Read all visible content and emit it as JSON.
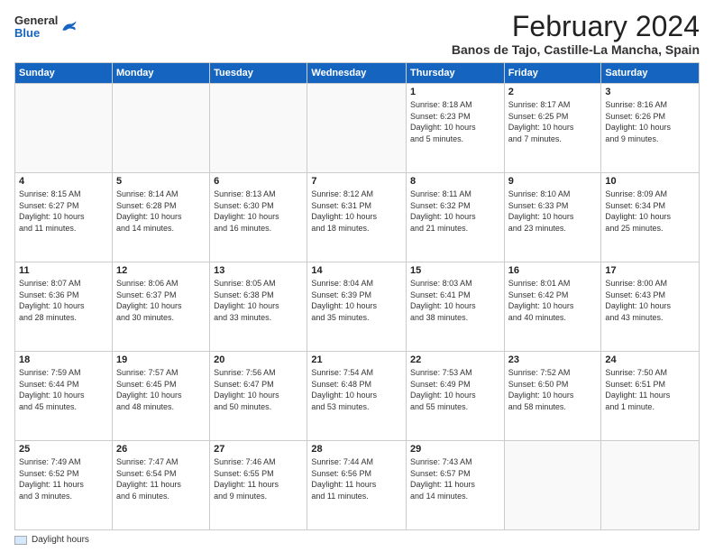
{
  "logo": {
    "general": "General",
    "blue": "Blue"
  },
  "title": "February 2024",
  "subtitle": "Banos de Tajo, Castille-La Mancha, Spain",
  "days_of_week": [
    "Sunday",
    "Monday",
    "Tuesday",
    "Wednesday",
    "Thursday",
    "Friday",
    "Saturday"
  ],
  "legend_label": "Daylight hours",
  "weeks": [
    [
      {
        "day": "",
        "info": ""
      },
      {
        "day": "",
        "info": ""
      },
      {
        "day": "",
        "info": ""
      },
      {
        "day": "",
        "info": ""
      },
      {
        "day": "1",
        "info": "Sunrise: 8:18 AM\nSunset: 6:23 PM\nDaylight: 10 hours\nand 5 minutes."
      },
      {
        "day": "2",
        "info": "Sunrise: 8:17 AM\nSunset: 6:25 PM\nDaylight: 10 hours\nand 7 minutes."
      },
      {
        "day": "3",
        "info": "Sunrise: 8:16 AM\nSunset: 6:26 PM\nDaylight: 10 hours\nand 9 minutes."
      }
    ],
    [
      {
        "day": "4",
        "info": "Sunrise: 8:15 AM\nSunset: 6:27 PM\nDaylight: 10 hours\nand 11 minutes."
      },
      {
        "day": "5",
        "info": "Sunrise: 8:14 AM\nSunset: 6:28 PM\nDaylight: 10 hours\nand 14 minutes."
      },
      {
        "day": "6",
        "info": "Sunrise: 8:13 AM\nSunset: 6:30 PM\nDaylight: 10 hours\nand 16 minutes."
      },
      {
        "day": "7",
        "info": "Sunrise: 8:12 AM\nSunset: 6:31 PM\nDaylight: 10 hours\nand 18 minutes."
      },
      {
        "day": "8",
        "info": "Sunrise: 8:11 AM\nSunset: 6:32 PM\nDaylight: 10 hours\nand 21 minutes."
      },
      {
        "day": "9",
        "info": "Sunrise: 8:10 AM\nSunset: 6:33 PM\nDaylight: 10 hours\nand 23 minutes."
      },
      {
        "day": "10",
        "info": "Sunrise: 8:09 AM\nSunset: 6:34 PM\nDaylight: 10 hours\nand 25 minutes."
      }
    ],
    [
      {
        "day": "11",
        "info": "Sunrise: 8:07 AM\nSunset: 6:36 PM\nDaylight: 10 hours\nand 28 minutes."
      },
      {
        "day": "12",
        "info": "Sunrise: 8:06 AM\nSunset: 6:37 PM\nDaylight: 10 hours\nand 30 minutes."
      },
      {
        "day": "13",
        "info": "Sunrise: 8:05 AM\nSunset: 6:38 PM\nDaylight: 10 hours\nand 33 minutes."
      },
      {
        "day": "14",
        "info": "Sunrise: 8:04 AM\nSunset: 6:39 PM\nDaylight: 10 hours\nand 35 minutes."
      },
      {
        "day": "15",
        "info": "Sunrise: 8:03 AM\nSunset: 6:41 PM\nDaylight: 10 hours\nand 38 minutes."
      },
      {
        "day": "16",
        "info": "Sunrise: 8:01 AM\nSunset: 6:42 PM\nDaylight: 10 hours\nand 40 minutes."
      },
      {
        "day": "17",
        "info": "Sunrise: 8:00 AM\nSunset: 6:43 PM\nDaylight: 10 hours\nand 43 minutes."
      }
    ],
    [
      {
        "day": "18",
        "info": "Sunrise: 7:59 AM\nSunset: 6:44 PM\nDaylight: 10 hours\nand 45 minutes."
      },
      {
        "day": "19",
        "info": "Sunrise: 7:57 AM\nSunset: 6:45 PM\nDaylight: 10 hours\nand 48 minutes."
      },
      {
        "day": "20",
        "info": "Sunrise: 7:56 AM\nSunset: 6:47 PM\nDaylight: 10 hours\nand 50 minutes."
      },
      {
        "day": "21",
        "info": "Sunrise: 7:54 AM\nSunset: 6:48 PM\nDaylight: 10 hours\nand 53 minutes."
      },
      {
        "day": "22",
        "info": "Sunrise: 7:53 AM\nSunset: 6:49 PM\nDaylight: 10 hours\nand 55 minutes."
      },
      {
        "day": "23",
        "info": "Sunrise: 7:52 AM\nSunset: 6:50 PM\nDaylight: 10 hours\nand 58 minutes."
      },
      {
        "day": "24",
        "info": "Sunrise: 7:50 AM\nSunset: 6:51 PM\nDaylight: 11 hours\nand 1 minute."
      }
    ],
    [
      {
        "day": "25",
        "info": "Sunrise: 7:49 AM\nSunset: 6:52 PM\nDaylight: 11 hours\nand 3 minutes."
      },
      {
        "day": "26",
        "info": "Sunrise: 7:47 AM\nSunset: 6:54 PM\nDaylight: 11 hours\nand 6 minutes."
      },
      {
        "day": "27",
        "info": "Sunrise: 7:46 AM\nSunset: 6:55 PM\nDaylight: 11 hours\nand 9 minutes."
      },
      {
        "day": "28",
        "info": "Sunrise: 7:44 AM\nSunset: 6:56 PM\nDaylight: 11 hours\nand 11 minutes."
      },
      {
        "day": "29",
        "info": "Sunrise: 7:43 AM\nSunset: 6:57 PM\nDaylight: 11 hours\nand 14 minutes."
      },
      {
        "day": "",
        "info": ""
      },
      {
        "day": "",
        "info": ""
      }
    ]
  ]
}
